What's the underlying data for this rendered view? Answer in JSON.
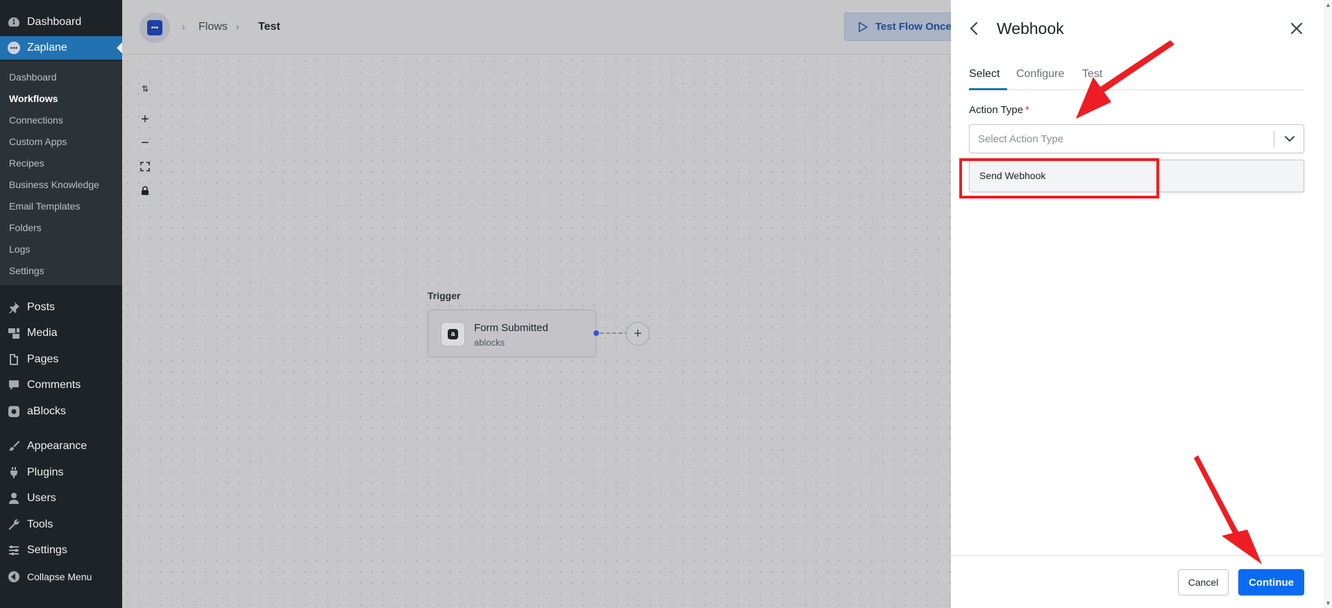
{
  "wp_menu": {
    "items_top": [
      {
        "label": "Dashboard",
        "icon": "dashboard-icon"
      },
      {
        "label": "Zaplane",
        "icon": "zaplane-icon"
      }
    ],
    "submenu": [
      "Dashboard",
      "Workflows",
      "Connections",
      "Custom Apps",
      "Recipes",
      "Business Knowledge",
      "Email Templates",
      "Folders",
      "Logs",
      "Settings"
    ],
    "submenu_active": "Workflows",
    "items_bottom": [
      {
        "label": "Posts",
        "icon": "pin-icon"
      },
      {
        "label": "Media",
        "icon": "media-icon"
      },
      {
        "label": "Pages",
        "icon": "pages-icon"
      },
      {
        "label": "Comments",
        "icon": "comment-icon"
      },
      {
        "label": "aBlocks",
        "icon": "ablocks-icon"
      },
      {
        "label": "Appearance",
        "icon": "brush-icon"
      },
      {
        "label": "Plugins",
        "icon": "plug-icon"
      },
      {
        "label": "Users",
        "icon": "user-icon"
      },
      {
        "label": "Tools",
        "icon": "wrench-icon"
      },
      {
        "label": "Settings",
        "icon": "sliders-icon"
      },
      {
        "label": "Collapse Menu",
        "icon": "collapse-icon"
      }
    ]
  },
  "topbar": {
    "breadcrumb": [
      "Flows",
      "Test"
    ],
    "test_button": "Test Flow Once"
  },
  "canvas": {
    "controls": [
      "sort-icon",
      "zoom-in-icon",
      "zoom-out-icon",
      "fit-view-icon",
      "lock-icon"
    ],
    "trigger_label": "Trigger",
    "node_title": "Form Submitted",
    "node_subtitle": "ablocks"
  },
  "panel": {
    "title": "Webhook",
    "tabs": [
      "Select",
      "Configure",
      "Test"
    ],
    "active_tab": "Select",
    "field_label": "Action Type",
    "required_mark": "*",
    "placeholder": "Select Action Type",
    "options": [
      "Send Webhook"
    ],
    "cancel": "Cancel",
    "continue": "Continue"
  },
  "colors": {
    "wp_sidebar": "#1d2327",
    "wp_accent": "#2271b1",
    "primary_button": "#0a6af2",
    "annotation": "#ee1d23"
  }
}
